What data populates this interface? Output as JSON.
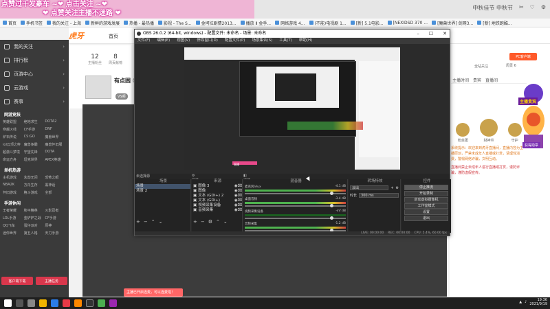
{
  "browser": {
    "banner_line1": "点赞过千发豪车 ~❤ 点击关注 ~❤",
    "banner_line2": "❤ 点赞关注主播不迷路 ❤",
    "tab_right": [
      "中秋佳节 中秋节",
      "✂",
      "♡",
      "⚙"
    ],
    "url": "https://www.huya.com/",
    "bookmarks": [
      "首页",
      "手机书签",
      "我的关注 - 上海",
      "新鲜的游戏发展",
      "热播 - 最热播",
      "影视 - The S...",
      "金坷拉剧情2013...",
      "播放 Ⅱ 金手...",
      "网络游戏 4...",
      "(不能)电视剧 1...",
      "[新] 5.1电影...",
      "[NEXIDSD 370 ...",
      "[魔兽世界] 剑网3...",
      "[新] 地铁跑酷..."
    ]
  },
  "leftnav": {
    "items": [
      {
        "label": "我的关注"
      },
      {
        "label": "排行榜"
      },
      {
        "label": "页游中心"
      },
      {
        "label": "云游戏"
      },
      {
        "label": "赛事"
      }
    ],
    "sections": [
      {
        "title": "网游竞技",
        "entries": [
          "英雄联盟",
          "绝地求生",
          "DOTA2",
          "穿越火线",
          "CF手游",
          "DNF",
          "炉石传说",
          "CS:GO",
          "魔兽世界",
          "lol云顶之弈",
          "魔兽争霸",
          "魔兽怀旧服",
          "超激斗梦境",
          "守望先锋",
          "DOTA",
          "命运方舟",
          "坦克世界",
          "APEX英雄"
        ]
      },
      {
        "title": "单机热游",
        "entries": [
          "主机游戏",
          "永劫无间",
          "恐怖之眼",
          "NBA2K",
          "方舟生存",
          "黑神话",
          "怀旧游戏",
          "格斗游戏",
          "全部"
        ]
      },
      {
        "title": "手游休闲",
        "entries": [
          "王者荣耀",
          "和平精英",
          "火影忍者",
          "LOL手游",
          "金铲铲之战",
          "CF手游",
          "QQ飞车",
          "蛋仔派对",
          "原神",
          "迷你世界",
          "第五人格",
          "天刀手游"
        ]
      }
    ],
    "button_client": "客户端下载",
    "button_task": "主播任务"
  },
  "site": {
    "logo": "虎牙",
    "home_label": "首页",
    "stat_fans": "12",
    "stat_fans_label": "主播粉丝",
    "stat_rank": "8",
    "stat_rank_label": "周贡献榜",
    "room_name": "有点困 ☺",
    "room_badge": "VS频"
  },
  "obs": {
    "title": "OBS 26.0.2 (64-bit, windows) - 配置文件: 未命名 - 场景: 未命名",
    "menu": [
      "文件(F)",
      "编辑(E)",
      "视图(V)",
      "停靠窗口(D)",
      "配置文件(P)",
      "场景集合(S)",
      "工具(T)",
      "帮助(H)"
    ],
    "preview_tag": "直播",
    "headers": {
      "scenes": "场景",
      "sources": "来源",
      "mixer": "混音器",
      "transitions": "转场特效",
      "controls": "控件"
    },
    "no_source_selected": "未选择源",
    "properties_label": "属性",
    "filters_label": "滤镜",
    "scenes": [
      "场景",
      "场景 2"
    ],
    "sources": [
      "图像 3",
      "图像",
      "文本 (GDI+) 2",
      "文本 (GDI+)",
      "视频采集设备",
      "音频采集"
    ],
    "mixer": [
      {
        "name": "麦克风/Aux",
        "db": "-4.1 dB"
      },
      {
        "name": "桌面音频",
        "db": "-3.4 dB"
      },
      {
        "name": "视频采集设备",
        "db": "-inf dB"
      },
      {
        "name": "音频采集",
        "db": "-1.2 dB"
      }
    ],
    "transition_type": "淡出",
    "duration_label": "时长",
    "duration_value": "300 ms",
    "controls": [
      "停止推流",
      "开始录制",
      "启动虚拟摄像机",
      "工作室模式",
      "设置",
      "退出"
    ],
    "status": [
      "LIVE: 00:00:00",
      "REC: 00:00:00",
      "CPU: 5.4%, 60.00 fps"
    ]
  },
  "rightpanel": {
    "pc_client": "PC客户端",
    "small_text": "全站关注",
    "stat_text": "周贡 6",
    "tabs": [
      "主播时间",
      "贵宾",
      "直播间"
    ],
    "rank_names": [
      "粉丝团",
      "财神爷",
      "守护"
    ],
    "chat_system": "系统提示：欢迎来到虎牙直播间，直播内容为主播原创，严禁未成年人直播或打赏，请理性消费，警惕网络诈骗，文明互动。",
    "chat_warn": "直播间禁止未成年人进行直播或打赏，谨防诈骗，谨防虚假宣传。"
  },
  "avatar_overlay": {
    "label1": "主播贵宾",
    "label2": "获得勋章"
  },
  "notice": "主播已开启连麦，可以连麦啦！",
  "taskbar": {
    "clock_time": "19:36",
    "clock_date": "2021/9/19",
    "watermark": "虎牙"
  }
}
